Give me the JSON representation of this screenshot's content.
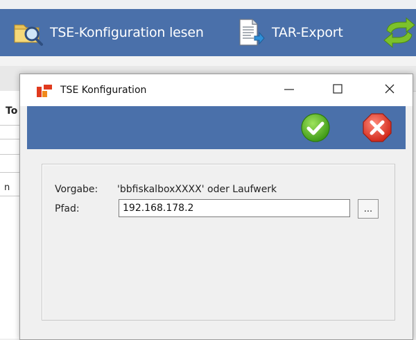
{
  "app": {
    "toolbar": {
      "read_config_label": "TSE-Konfiguration lesen",
      "tar_export_label": "TAR-Export"
    },
    "table": {
      "column_header": "To",
      "row_cell": "n"
    }
  },
  "dialog": {
    "title": "TSE Konfiguration",
    "window_buttons": {
      "minimize": "—",
      "maximize": "☐",
      "close": "✕"
    },
    "form": {
      "vorgabe_label": "Vorgabe:",
      "vorgabe_value": "'bbfiskalboxXXXX' oder Laufwerk",
      "pfad_label": "Pfad:",
      "pfad_value": "192.168.178.2",
      "browse_label": "..."
    }
  },
  "icons": {
    "read_config": "folder-magnifier-icon",
    "tar_export": "document-export-icon",
    "sync": "sync-arrows-icon",
    "app": "app-logo-icon",
    "ok": "ok-check-icon",
    "cancel": "cancel-x-icon"
  },
  "colors": {
    "header_blue": "#4a70aa",
    "ok_green": "#4caf28",
    "cancel_red": "#e0342a"
  }
}
